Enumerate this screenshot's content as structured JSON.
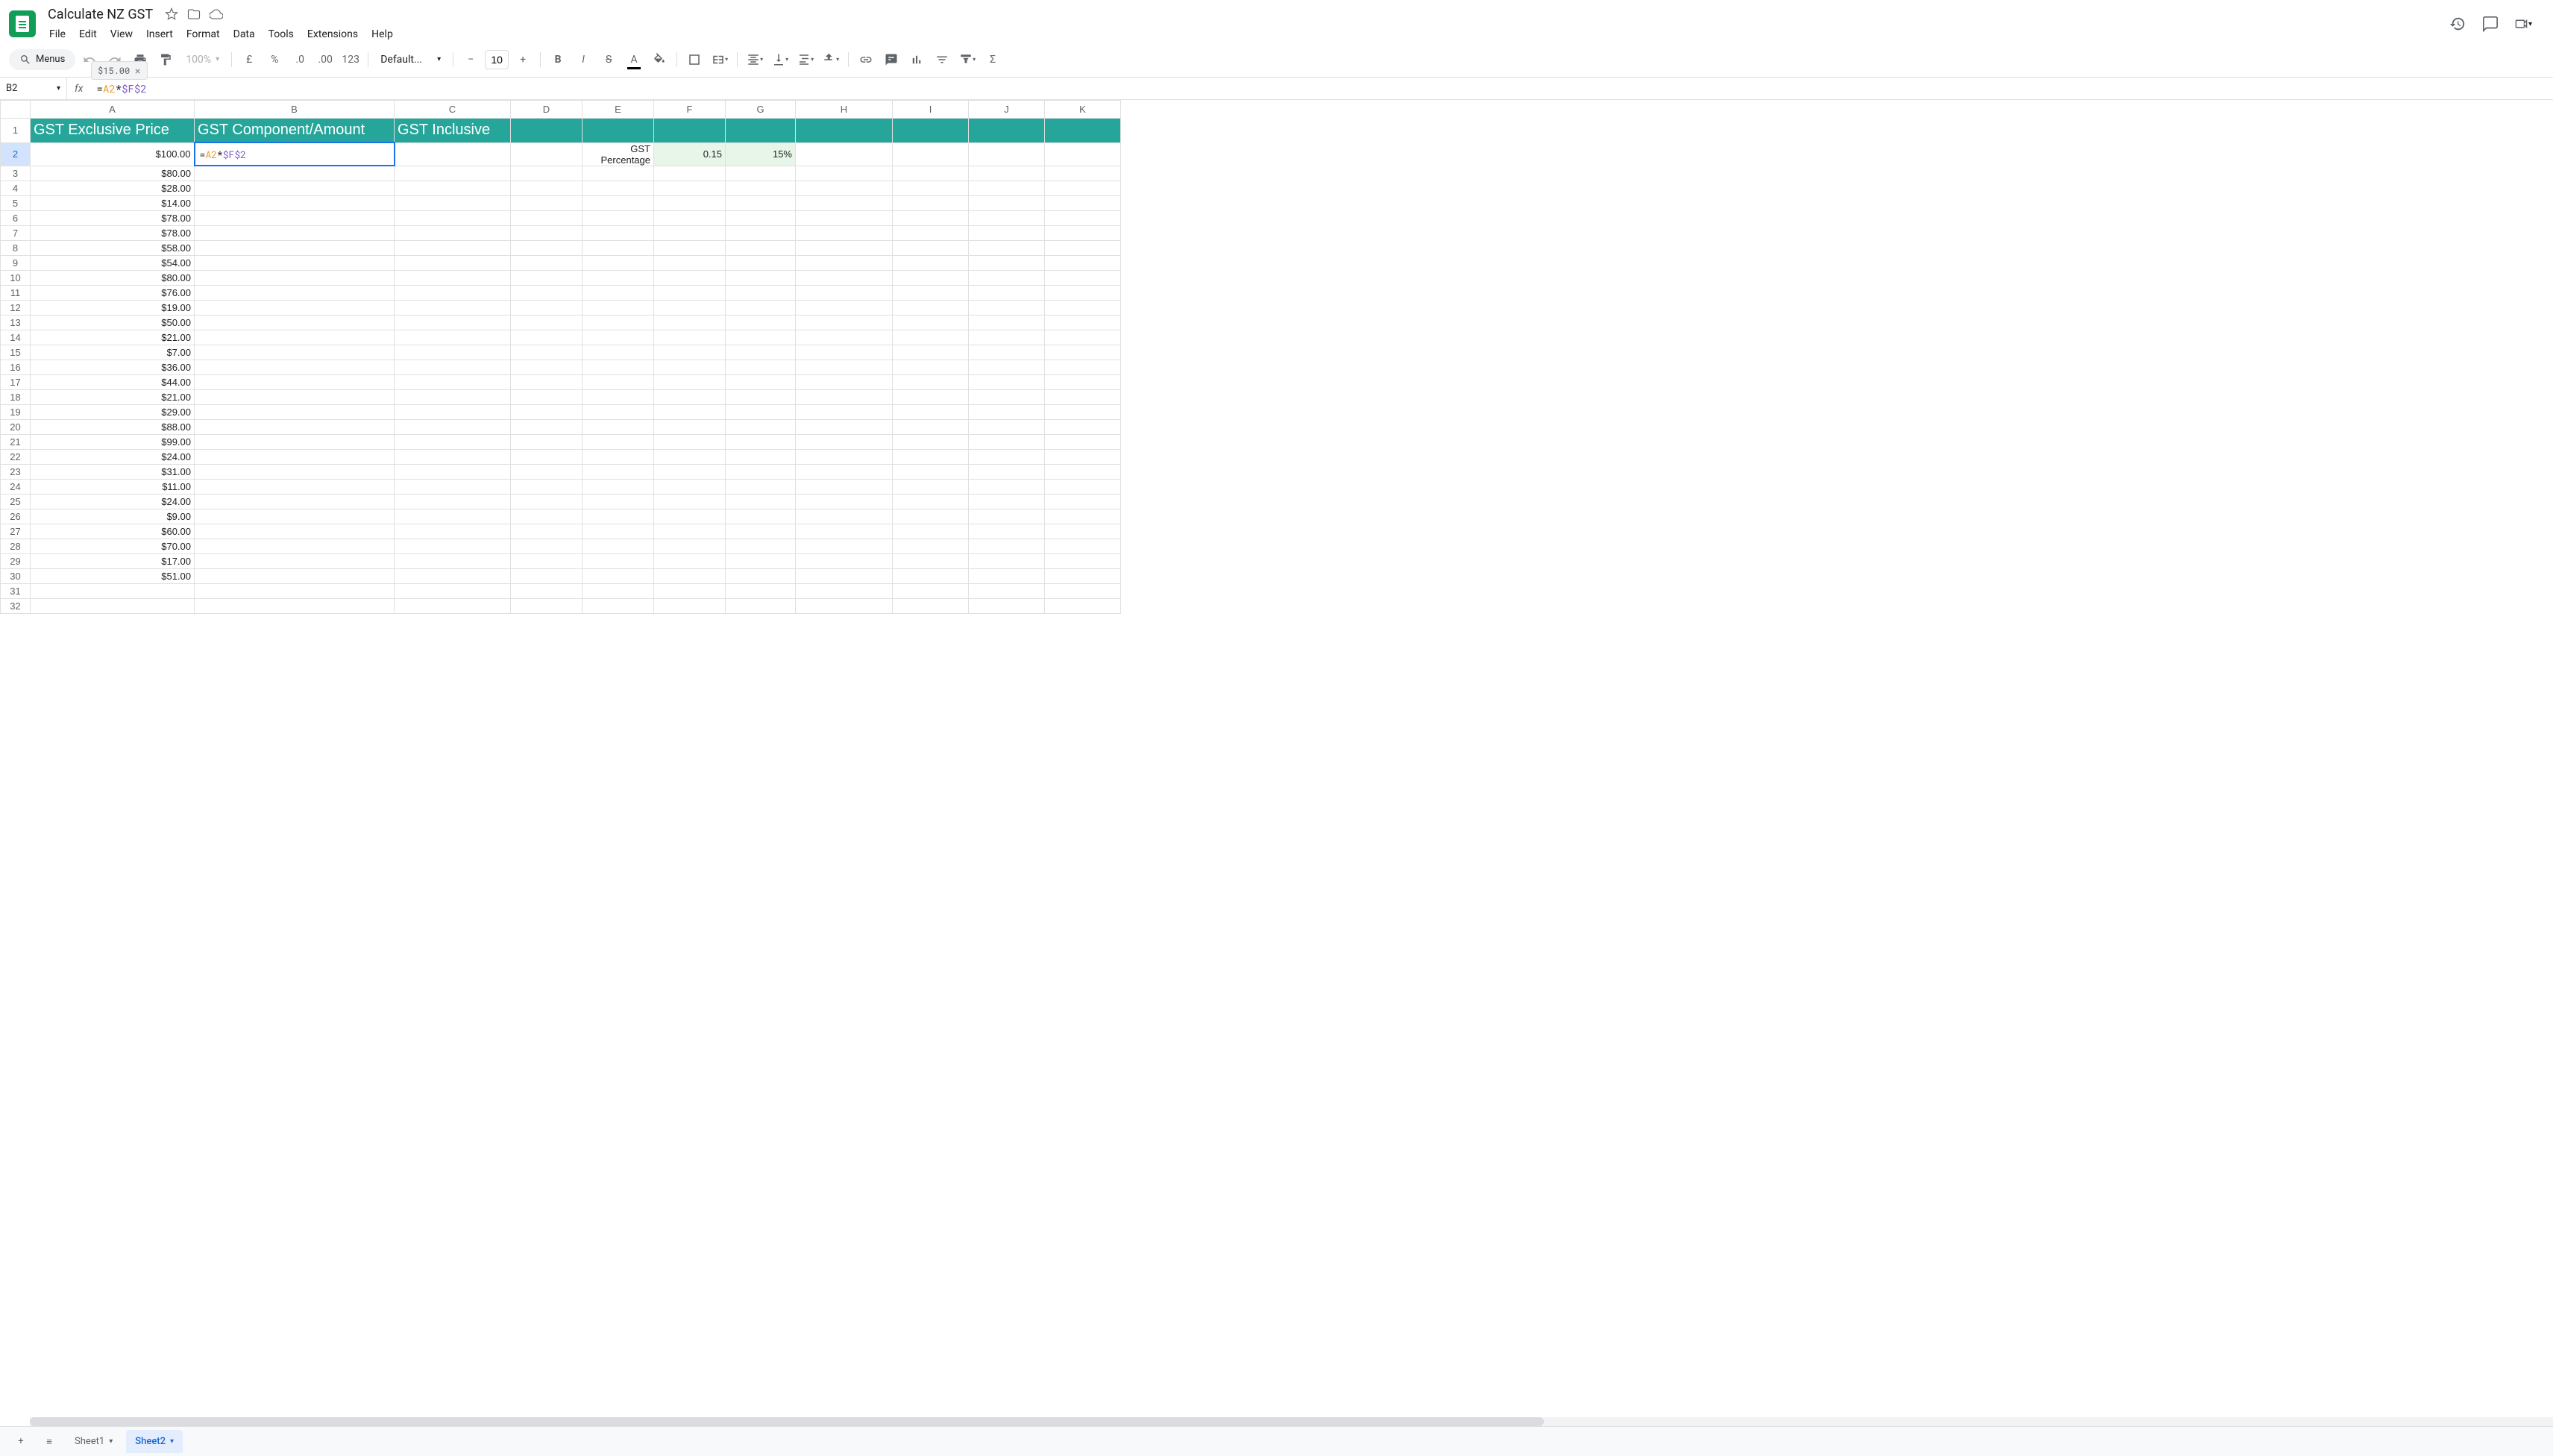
{
  "document": {
    "title": "Calculate NZ GST"
  },
  "menu": {
    "file": "File",
    "edit": "Edit",
    "view": "View",
    "insert": "Insert",
    "format": "Format",
    "data": "Data",
    "tools": "Tools",
    "extensions": "Extensions",
    "help": "Help"
  },
  "toolbar": {
    "search_label": "Menus",
    "zoom": "100%",
    "font": "Default...",
    "font_size": "10",
    "currency": "£",
    "percent": "%",
    "decrease_dec": ".0←",
    "increase_dec": ".00→",
    "format123": "123"
  },
  "formula_preview": {
    "value": "$15.00"
  },
  "name_box": {
    "value": "B2"
  },
  "formula": {
    "raw": "=A2*$F$2",
    "eq": "=",
    "ref1": "A2",
    "op": "*",
    "ref2": "$F$2"
  },
  "columns": [
    "A",
    "B",
    "C",
    "D",
    "E",
    "F",
    "G",
    "H",
    "I",
    "J",
    "K"
  ],
  "headers": {
    "a": "GST Exclusive Price",
    "b": "GST Component/Amount",
    "c": "GST Inclusive"
  },
  "row2": {
    "e_label": "GST Percentage",
    "f_val": "0.15",
    "g_val": "15%"
  },
  "prices": [
    "$100.00",
    "$80.00",
    "$28.00",
    "$14.00",
    "$78.00",
    "$78.00",
    "$58.00",
    "$54.00",
    "$80.00",
    "$76.00",
    "$19.00",
    "$50.00",
    "$21.00",
    "$7.00",
    "$36.00",
    "$44.00",
    "$21.00",
    "$29.00",
    "$88.00",
    "$99.00",
    "$24.00",
    "$31.00",
    "$11.00",
    "$24.00",
    "$9.00",
    "$60.00",
    "$70.00",
    "$17.00",
    "$51.00"
  ],
  "rows_total": 32,
  "sheets": {
    "sheet1": "Sheet1",
    "sheet2": "Sheet2"
  }
}
